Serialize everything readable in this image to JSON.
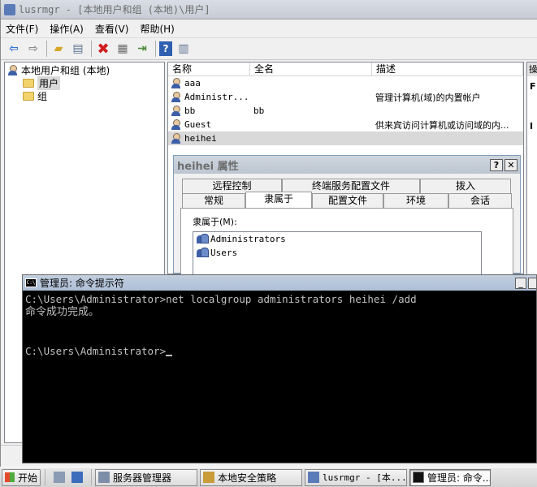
{
  "mmc": {
    "title": "lusrmgr - [本地用户和组 (本地)\\用户]",
    "menus": [
      "文件(F)",
      "操作(A)",
      "查看(V)",
      "帮助(H)"
    ],
    "toolbar_icons": [
      "back-arrow-icon",
      "forward-arrow-icon",
      "up-folder-icon",
      "show-hide-tree-icon",
      "delete-icon",
      "properties-icon",
      "export-list-icon",
      "help-icon",
      "show-hide-action-pane-icon"
    ],
    "tree": {
      "root": "本地用户和组 (本地)",
      "children": [
        "用户",
        "组"
      ]
    },
    "list": {
      "columns": [
        "名称",
        "全名",
        "描述"
      ],
      "rows": [
        {
          "name": "aaa",
          "fullname": "",
          "desc": ""
        },
        {
          "name": "Administr...",
          "fullname": "",
          "desc": "管理计算机(域)的内置帐户"
        },
        {
          "name": "bb",
          "fullname": "bb",
          "desc": ""
        },
        {
          "name": "Guest",
          "fullname": "",
          "desc": "供来宾访问计算机或访问域的内..."
        },
        {
          "name": "heihei",
          "fullname": "",
          "desc": ""
        }
      ]
    },
    "right_pane_chars": [
      "操",
      "F",
      "",
      "",
      "",
      "I"
    ]
  },
  "props": {
    "title": "heihei 属性",
    "help_btn": "?",
    "close_btn": "✕",
    "tabs_row1": [
      "远程控制",
      "终端服务配置文件",
      "拨入"
    ],
    "tabs_row2": [
      "常规",
      "隶属于",
      "配置文件",
      "环境",
      "会话"
    ],
    "member_label": "隶属于(M):",
    "members": [
      "Administrators",
      "Users"
    ]
  },
  "cmd": {
    "title": "管理员: 命令提示符",
    "icon_text": "C:\\",
    "lines": [
      "C:\\Users\\Administrator>net localgroup administrators heihei /add",
      "命令成功完成。",
      "",
      "",
      "C:\\Users\\Administrator>"
    ]
  },
  "taskbar": {
    "start": "开始",
    "buttons": [
      "服务器管理器",
      "本地安全策略",
      "lusrmgr - [本...",
      "管理员: 命令..."
    ]
  }
}
